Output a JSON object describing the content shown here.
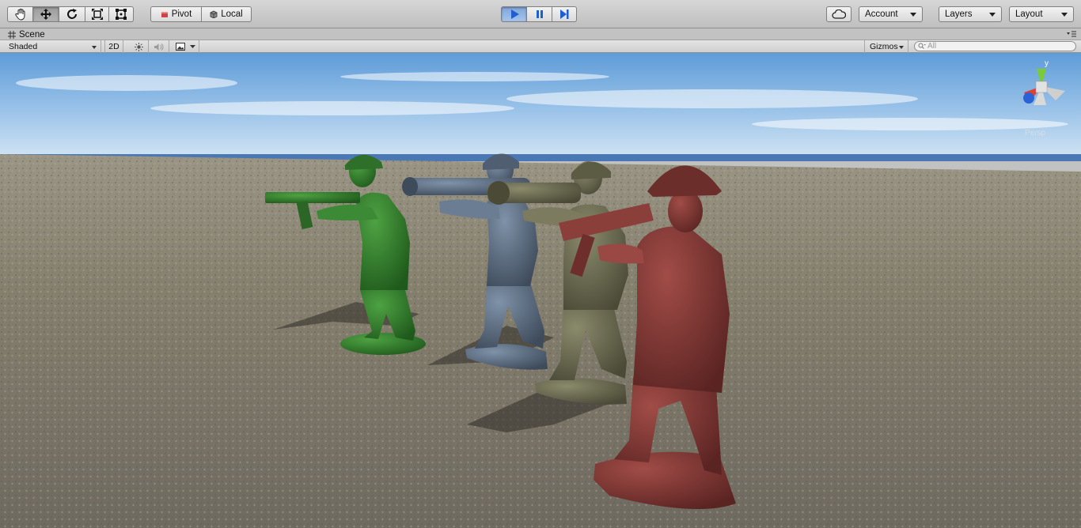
{
  "toolbar": {
    "tools": [
      "hand-tool",
      "move-tool",
      "rotate-tool",
      "scale-tool",
      "rect-tool"
    ],
    "pivot_label": "Pivot",
    "local_label": "Local",
    "account_label": "Account",
    "layers_label": "Layers",
    "layout_label": "Layout"
  },
  "scene_tab": {
    "label": "Scene"
  },
  "scene_controls": {
    "shading_mode": "Shaded",
    "mode_2d_label": "2D",
    "gizmos_label": "Gizmos",
    "search_placeholder": "All"
  },
  "orientation_gizmo": {
    "y_label": "y",
    "view_label": "Persp"
  },
  "colors": {
    "toolbar_bg": "#c8c8c8",
    "play_active": "#2f6fd6",
    "sky_top": "#5d9bd9",
    "sky_bottom": "#cde1f2",
    "ground": "#7d776d",
    "soldier_green": "#2f7a2a",
    "soldier_blue": "#59697c",
    "soldier_olive": "#6b6a50",
    "soldier_red": "#7a3532"
  }
}
